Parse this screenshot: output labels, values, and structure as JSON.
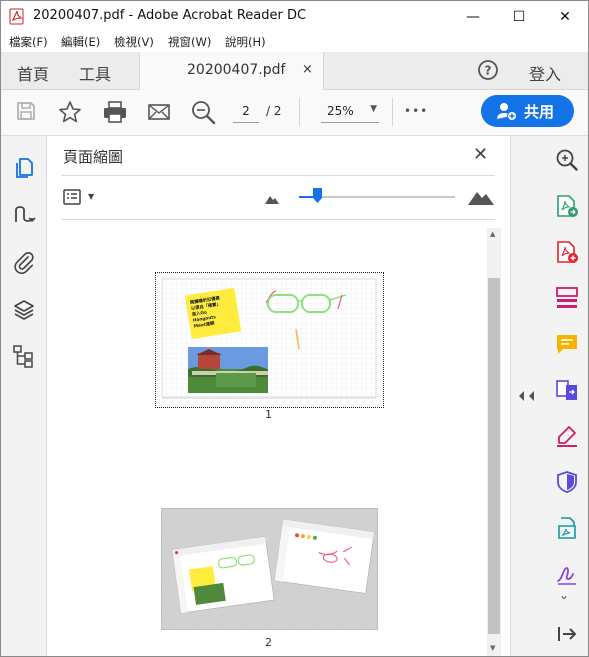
{
  "window": {
    "title": "20200407.pdf - Adobe Acrobat Reader DC",
    "minimize": "—",
    "maximize": "☐",
    "close": "✕"
  },
  "menu": [
    "檔案(F)",
    "編輯(E)",
    "檢視(V)",
    "視窗(W)",
    "說明(H)"
  ],
  "tabs": {
    "home": "首頁",
    "tools": "工具",
    "document": "20200407.pdf",
    "close": "×",
    "help": "?",
    "signin": "登入"
  },
  "toolbar": {
    "current_page": "2",
    "total_pages": "/ 2",
    "zoom": "25%",
    "more": "•••",
    "share": "共用"
  },
  "panel": {
    "title": "頁面縮圖",
    "close": "✕",
    "thumbnail_size": 0.12,
    "pages": [
      {
        "label": "1",
        "selected": true,
        "note_text": "閱讀曝折扣優惠以便自「確實」進入Go Hangouts Meet連網"
      },
      {
        "label": "2",
        "selected": false
      }
    ]
  },
  "icons": {
    "left_rail": [
      "pages-icon",
      "bookmarks-icon",
      "attachments-icon",
      "layers-icon",
      "tags-icon"
    ],
    "right_rail": [
      "search-zoom-icon",
      "export-pdf-icon",
      "create-pdf-icon",
      "organize-pages-icon",
      "comment-icon",
      "combine-files-icon",
      "fill-sign-icon",
      "protect-icon",
      "edit-pdf-icon",
      "sign-icon",
      "expand-down-icon",
      "collapse-pane-icon"
    ]
  },
  "colors": {
    "accent": "#1473e6",
    "pdf_red": "#e0262c"
  }
}
